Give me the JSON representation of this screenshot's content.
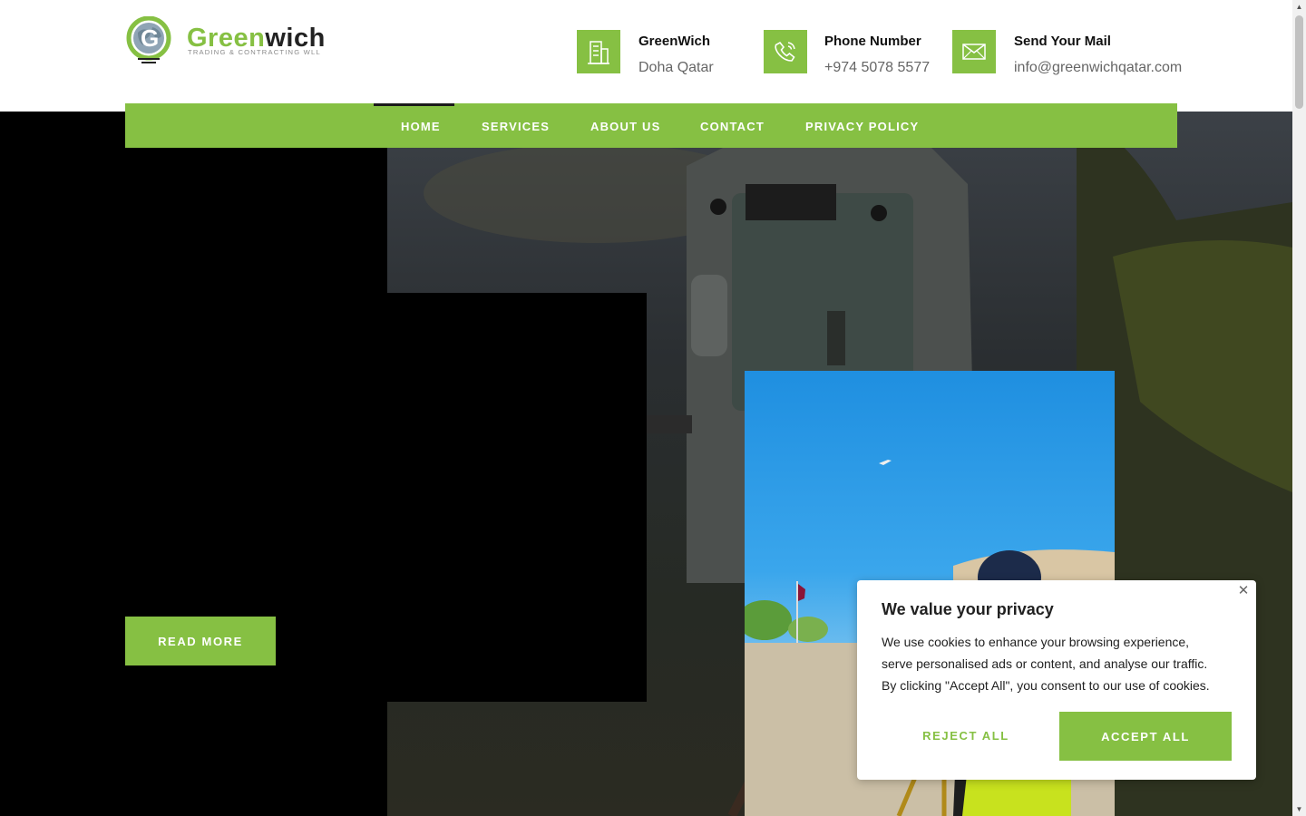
{
  "brand": {
    "name_part1": "Green",
    "name_part2": "wich",
    "tagline": "TRADING & CONTRACTING WLL",
    "accent_color": "#86c043"
  },
  "header_info": [
    {
      "icon": "building-icon",
      "title": "GreenWich",
      "value": "Doha Qatar"
    },
    {
      "icon": "phone-icon",
      "title": "Phone Number",
      "value": "+974 5078 5577"
    },
    {
      "icon": "mail-icon",
      "title": "Send Your Mail",
      "value": "info@greenwichqatar.com"
    }
  ],
  "nav": {
    "items": [
      "HOME",
      "SERVICES",
      "ABOUT US",
      "CONTACT",
      "PRIVACY POLICY"
    ],
    "active": "HOME"
  },
  "hero": {
    "read_more_label": "READ MORE"
  },
  "cookie_banner": {
    "title": "We value your privacy",
    "text": "We use cookies to enhance your browsing experience, serve personalised ads or content, and analyse our traffic. By clicking \"Accept All\", you consent to our use of cookies.",
    "reject_label": "REJECT ALL",
    "accept_label": "ACCEPT ALL",
    "close_icon": "close-icon"
  }
}
